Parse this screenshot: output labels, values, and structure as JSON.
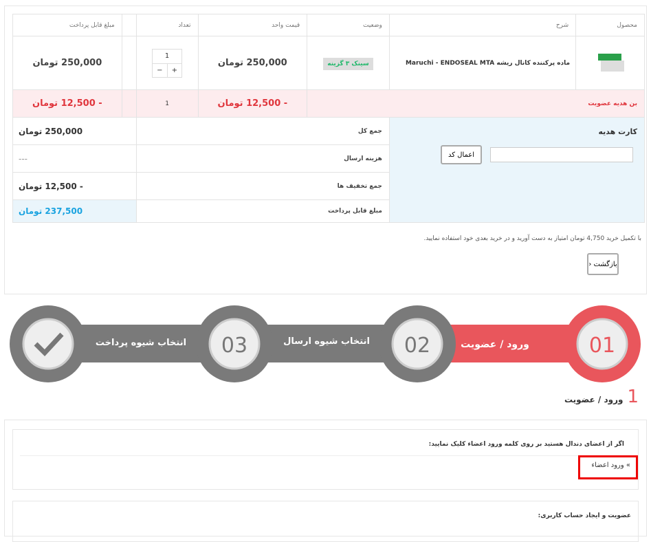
{
  "cart": {
    "headers": [
      "محصول",
      "شرح",
      "وضعیت",
      "قیمت واحد",
      "تعداد",
      "",
      "مبلغ قابل پرداخت"
    ],
    "product": {
      "name": "ماده پرکننده کانال ریشه Maruchi - ENDOSEAL MTA",
      "status": "سینک ۳ گزینه",
      "unit_price": "250,000 تومان",
      "quantity": "1",
      "total": "250,000 تومان"
    },
    "discount": {
      "label": "بن هدیه عضویت",
      "unit_price": "- 12,500 تومان",
      "quantity": "1",
      "total": "- 12,500 تومان"
    },
    "gift_card": {
      "title": "کارت هدیه",
      "input_value": "",
      "apply_label": "اعمال کد"
    },
    "totals": [
      {
        "label": "جمع کل",
        "value": "250,000 تومان"
      },
      {
        "label": "هزینه ارسال",
        "value": "---"
      },
      {
        "label": "جمع تخفیف ها",
        "value": "- 12,500 تومان"
      },
      {
        "label": "مبلغ قابل پرداخت",
        "value": "237,500 تومان"
      }
    ],
    "note": "با تکمیل خرید 4,750 تومان امتیاز به دست آورید و در خرید بعدی خود استفاده نمایید.",
    "back_label": "بازگشت"
  },
  "steps": [
    {
      "number": "01",
      "label": "ورود / عضویت",
      "active": true
    },
    {
      "number": "02",
      "label": "انتخاب شیوه ارسال",
      "active": false
    },
    {
      "number": "03",
      "label": "انتخاب شیوه پرداخت",
      "active": false
    },
    {
      "number": "",
      "label": "",
      "icon": "check-icon",
      "active": false
    }
  ],
  "colors": {
    "active": "#e9565c",
    "inactive": "#7a7a7a",
    "total": "#1aa3e0"
  },
  "section": {
    "number": "1",
    "title": "ورود / عضویت"
  },
  "login": {
    "prompt": "اگر از اعضای دندال هستید بر روی کلمه ورود اعضاء کلیک نمایید:",
    "link": "» ورود اعضاء"
  },
  "register": {
    "prompt": "عضویت و ایجاد حساب کاربری:"
  }
}
